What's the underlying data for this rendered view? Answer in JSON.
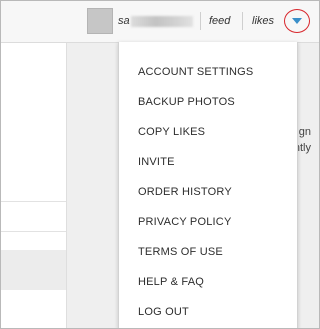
{
  "header": {
    "username_visible": "sa",
    "feed_label": "feed",
    "likes_label": "likes"
  },
  "background": {
    "line1": "to sign",
    "line2": "urrently"
  },
  "menu": {
    "items": [
      "ACCOUNT SETTINGS",
      "BACKUP PHOTOS",
      "COPY LIKES",
      "INVITE",
      "ORDER HISTORY",
      "PRIVACY POLICY",
      "TERMS OF USE",
      "HELP & FAQ",
      "LOG OUT"
    ]
  },
  "colors": {
    "highlight_circle": "#d8262c",
    "caret": "#3a8fc9"
  },
  "icons": {
    "avatar": "user-avatar",
    "dropdown": "caret-down-icon"
  }
}
